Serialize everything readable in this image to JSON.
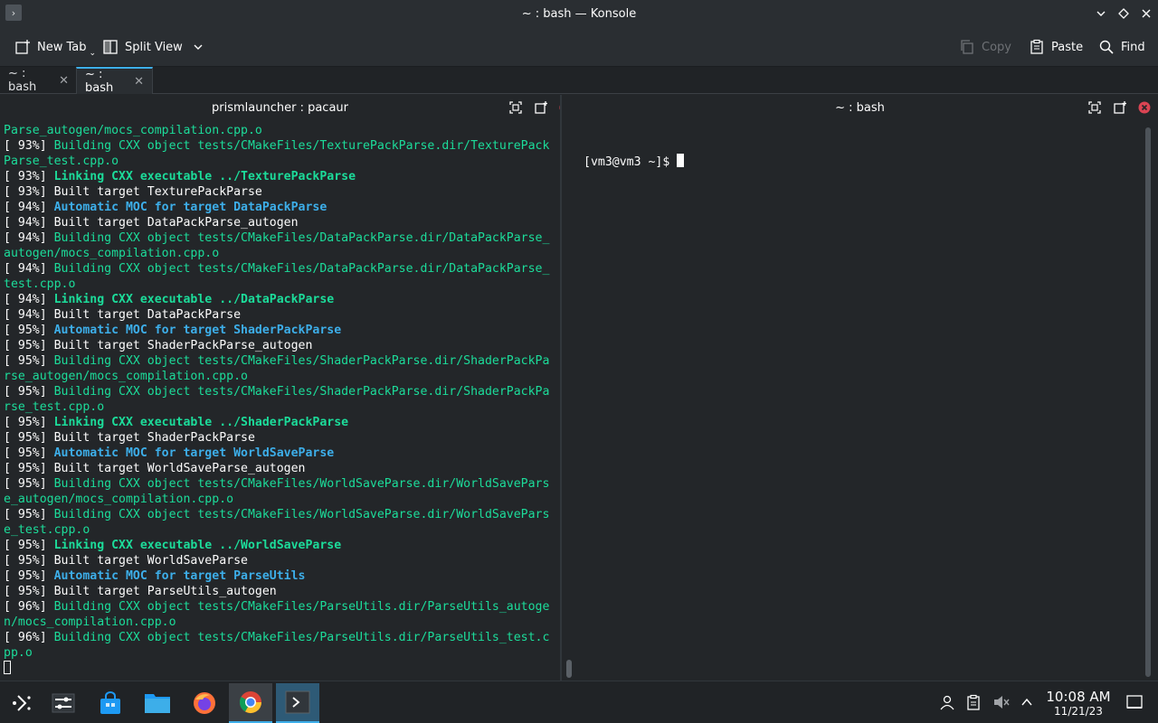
{
  "window": {
    "title": "~ : bash — Konsole"
  },
  "toolbar": {
    "new_tab": "New Tab",
    "split_view": "Split View",
    "copy": "Copy",
    "paste": "Paste",
    "find": "Find"
  },
  "tabs": [
    {
      "label": "~ : bash",
      "active": false
    },
    {
      "label": "~ : bash",
      "active": true
    }
  ],
  "left_pane": {
    "title": "prismlauncher : pacaur",
    "lines": [
      {
        "prefix": "",
        "text": "Parse_autogen/mocs_compilation.cpp.o",
        "style": "g"
      },
      {
        "prefix": "[ 93%] ",
        "text": "Building CXX object tests/CMakeFiles/TexturePackParse.dir/TexturePack",
        "style": "g"
      },
      {
        "prefix": "",
        "text": "Parse_test.cpp.o",
        "style": "g"
      },
      {
        "prefix": "[ 93%] ",
        "text": "Linking CXX executable ../TexturePackParse",
        "style": "gb"
      },
      {
        "prefix": "[ 93%] ",
        "text": "Built target TexturePackParse",
        "style": ""
      },
      {
        "prefix": "[ 94%] ",
        "text": "Automatic MOC for target DataPackParse",
        "style": "bb"
      },
      {
        "prefix": "[ 94%] ",
        "text": "Built target DataPackParse_autogen",
        "style": ""
      },
      {
        "prefix": "[ 94%] ",
        "text": "Building CXX object tests/CMakeFiles/DataPackParse.dir/DataPackParse_",
        "style": "g"
      },
      {
        "prefix": "",
        "text": "autogen/mocs_compilation.cpp.o",
        "style": "g"
      },
      {
        "prefix": "[ 94%] ",
        "text": "Building CXX object tests/CMakeFiles/DataPackParse.dir/DataPackParse_",
        "style": "g"
      },
      {
        "prefix": "",
        "text": "test.cpp.o",
        "style": "g"
      },
      {
        "prefix": "[ 94%] ",
        "text": "Linking CXX executable ../DataPackParse",
        "style": "gb"
      },
      {
        "prefix": "[ 94%] ",
        "text": "Built target DataPackParse",
        "style": ""
      },
      {
        "prefix": "[ 95%] ",
        "text": "Automatic MOC for target ShaderPackParse",
        "style": "bb"
      },
      {
        "prefix": "[ 95%] ",
        "text": "Built target ShaderPackParse_autogen",
        "style": ""
      },
      {
        "prefix": "[ 95%] ",
        "text": "Building CXX object tests/CMakeFiles/ShaderPackParse.dir/ShaderPackPa",
        "style": "g"
      },
      {
        "prefix": "",
        "text": "rse_autogen/mocs_compilation.cpp.o",
        "style": "g"
      },
      {
        "prefix": "[ 95%] ",
        "text": "Building CXX object tests/CMakeFiles/ShaderPackParse.dir/ShaderPackPa",
        "style": "g"
      },
      {
        "prefix": "",
        "text": "rse_test.cpp.o",
        "style": "g"
      },
      {
        "prefix": "[ 95%] ",
        "text": "Linking CXX executable ../ShaderPackParse",
        "style": "gb"
      },
      {
        "prefix": "[ 95%] ",
        "text": "Built target ShaderPackParse",
        "style": ""
      },
      {
        "prefix": "[ 95%] ",
        "text": "Automatic MOC for target WorldSaveParse",
        "style": "bb"
      },
      {
        "prefix": "[ 95%] ",
        "text": "Built target WorldSaveParse_autogen",
        "style": ""
      },
      {
        "prefix": "[ 95%] ",
        "text": "Building CXX object tests/CMakeFiles/WorldSaveParse.dir/WorldSavePars",
        "style": "g"
      },
      {
        "prefix": "",
        "text": "e_autogen/mocs_compilation.cpp.o",
        "style": "g"
      },
      {
        "prefix": "[ 95%] ",
        "text": "Building CXX object tests/CMakeFiles/WorldSaveParse.dir/WorldSavePars",
        "style": "g"
      },
      {
        "prefix": "",
        "text": "e_test.cpp.o",
        "style": "g"
      },
      {
        "prefix": "[ 95%] ",
        "text": "Linking CXX executable ../WorldSaveParse",
        "style": "gb"
      },
      {
        "prefix": "[ 95%] ",
        "text": "Built target WorldSaveParse",
        "style": ""
      },
      {
        "prefix": "[ 95%] ",
        "text": "Automatic MOC for target ParseUtils",
        "style": "bb"
      },
      {
        "prefix": "[ 95%] ",
        "text": "Built target ParseUtils_autogen",
        "style": ""
      },
      {
        "prefix": "[ 96%] ",
        "text": "Building CXX object tests/CMakeFiles/ParseUtils.dir/ParseUtils_autoge",
        "style": "g"
      },
      {
        "prefix": "",
        "text": "n/mocs_compilation.cpp.o",
        "style": "g"
      },
      {
        "prefix": "[ 96%] ",
        "text": "Building CXX object tests/CMakeFiles/ParseUtils.dir/ParseUtils_test.c",
        "style": "g"
      },
      {
        "prefix": "",
        "text": "pp.o",
        "style": "g"
      }
    ]
  },
  "right_pane": {
    "title": "~ : bash",
    "prompt": "[vm3@vm3 ~]$ "
  },
  "taskbar": {
    "clock_time": "10:08 AM",
    "clock_date": "11/21/23"
  },
  "colors": {
    "accent": "#3daee9",
    "close_red": "#da4453",
    "term_green": "#1cdc9a",
    "term_blue": "#3daee9"
  }
}
